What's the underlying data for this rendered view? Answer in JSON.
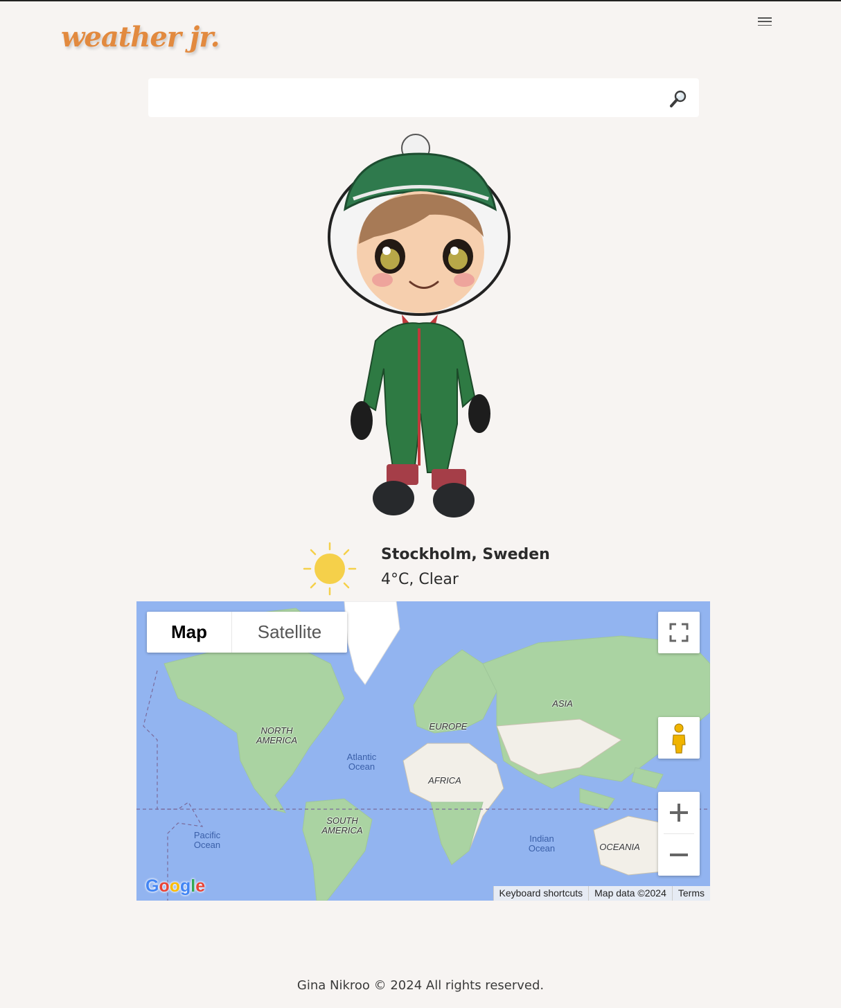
{
  "header": {
    "logo": "weather jr.",
    "menu_icon": "hamburger-icon"
  },
  "search": {
    "value": "",
    "placeholder": "",
    "icon": "magnifier-icon"
  },
  "weather": {
    "icon": "sun-icon",
    "location": "Stockholm, Sweden",
    "condition": "4°C, Clear",
    "illustration": "child-in-winter-snowsuit"
  },
  "map": {
    "type_controls": {
      "map": "Map",
      "satellite": "Satellite",
      "selected": "Map"
    },
    "labels": {
      "north_america": "NORTH AMERICA",
      "europe": "EUROPE",
      "asia": "ASIA",
      "africa": "AFRICA",
      "south_america": "SOUTH AMERICA",
      "oceania": "OCEANIA",
      "atlantic": "Atlantic Ocean",
      "pacific": "Pacific Ocean",
      "indian": "Indian Ocean"
    },
    "attribution": {
      "shortcuts": "Keyboard shortcuts",
      "data": "Map data ©2024",
      "terms": "Terms"
    },
    "brand": "Google"
  },
  "footer": {
    "text": "Gina Nikroo © 2024 All rights reserved."
  },
  "colors": {
    "accent": "#e28a3f",
    "background": "#f7f4f2",
    "ocean": "#92b4f0",
    "land": "#aad3a2",
    "sun": "#f5d04a"
  }
}
